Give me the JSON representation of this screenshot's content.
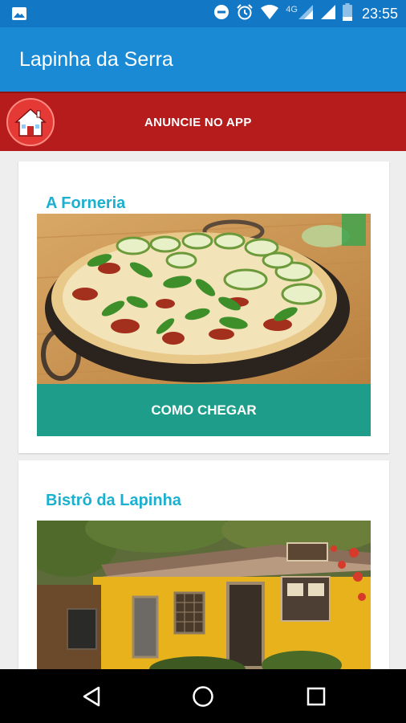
{
  "status_bar": {
    "time": "23:55",
    "network_label": "4G",
    "icons": [
      "image-icon",
      "do-not-disturb-icon",
      "alarm-icon",
      "wifi-icon",
      "signal-icon",
      "signal-icon",
      "battery-icon"
    ]
  },
  "app_bar": {
    "title": "Lapinha da Serra"
  },
  "ad_banner": {
    "label": "ANUNCIE NO APP",
    "icon": "home-icon"
  },
  "listings": [
    {
      "title": "A Forneria",
      "button_label": "COMO CHEGAR",
      "image": "pizza-photo"
    },
    {
      "title": "Bistrô da Lapinha",
      "image": "restaurant-facade-photo"
    }
  ],
  "nav_bar": {
    "icons": [
      "back-icon",
      "home-circle-icon",
      "recents-square-icon"
    ]
  },
  "colors": {
    "status_bar": "#1277c4",
    "app_bar": "#1a8ad4",
    "ad_banner": "#b71c1c",
    "title_accent": "#1bb0cf",
    "button": "#1e9e8a"
  }
}
